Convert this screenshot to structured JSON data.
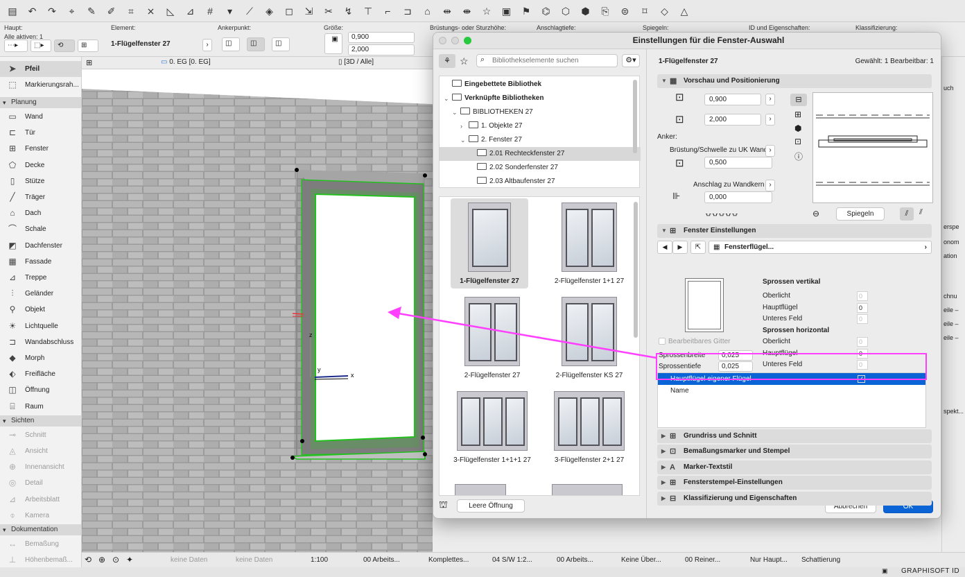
{
  "toolbar": {
    "icons": [
      "save-icon",
      "undo-icon",
      "redo-icon",
      "pointer-tool-icon",
      "eyedropper-icon",
      "syringe-icon",
      "magic-wand-icon",
      "trace-icon",
      "snap-guides-icon",
      "guide-lines-icon",
      "grid-snap-icon",
      "gravity-icon",
      "pen-set-icon",
      "layer-icon",
      "suspend-groups-icon",
      "measure-icon",
      "scissors-icon",
      "adjust-icon",
      "elevate-icon",
      "fillet-icon",
      "offset-icon",
      "roof-trim-icon",
      "distribute-icon",
      "align-icon",
      "favorites-icon",
      "selection-settings-icon",
      "flag-icon",
      "renovation-icon",
      "3d-explode-icon",
      "model-icon",
      "publisher-icon",
      "attributes-icon",
      "tag-icon",
      "view-icon",
      "solid-ops-icon"
    ]
  },
  "infobox": {
    "main_label": "Haupt:",
    "active_label": "Alle aktiven: 1",
    "element_label": "Element:",
    "element_value": "1-Flügelfenster 27",
    "anchor_label": "Ankerpunkt:",
    "size_label": "Größe:",
    "width": "0,900",
    "height": "2,000",
    "sill_label": "Brüstungs- oder Sturzhöhe:",
    "reveal_label": "Anschlagtiefe:",
    "mirror_label": "Spiegeln:",
    "id_label": "ID und Eigenschaften:",
    "class_label": "Klassifizierung:"
  },
  "tabs": {
    "floor": "0. EG [0. EG]",
    "view3d": "[3D / Alle]"
  },
  "palette": {
    "tools_top": [
      {
        "label": "Pfeil",
        "icon": "arrow-icon"
      },
      {
        "label": "Markierungsrah...",
        "icon": "marquee-icon"
      }
    ],
    "sections": [
      {
        "title": "Planung",
        "items": [
          {
            "label": "Wand",
            "icon": "wall-icon"
          },
          {
            "label": "Tür",
            "icon": "door-icon"
          },
          {
            "label": "Fenster",
            "icon": "window-icon"
          },
          {
            "label": "Decke",
            "icon": "slab-icon"
          },
          {
            "label": "Stütze",
            "icon": "column-icon"
          },
          {
            "label": "Träger",
            "icon": "beam-icon"
          },
          {
            "label": "Dach",
            "icon": "roof-icon"
          },
          {
            "label": "Schale",
            "icon": "shell-icon"
          },
          {
            "label": "Dachfenster",
            "icon": "skylight-icon"
          },
          {
            "label": "Fassade",
            "icon": "curtain-wall-icon"
          },
          {
            "label": "Treppe",
            "icon": "stair-icon"
          },
          {
            "label": "Geländer",
            "icon": "railing-icon"
          },
          {
            "label": "Objekt",
            "icon": "object-icon"
          },
          {
            "label": "Lichtquelle",
            "icon": "lamp-icon"
          },
          {
            "label": "Wandabschluss",
            "icon": "wall-end-icon"
          },
          {
            "label": "Morph",
            "icon": "morph-icon"
          },
          {
            "label": "Freifläche",
            "icon": "mesh-icon"
          },
          {
            "label": "Öffnung",
            "icon": "opening-icon"
          },
          {
            "label": "Raum",
            "icon": "zone-icon"
          }
        ]
      },
      {
        "title": "Sichten",
        "items": [
          {
            "label": "Schnitt",
            "icon": "section-icon"
          },
          {
            "label": "Ansicht",
            "icon": "elevation-icon"
          },
          {
            "label": "Innenansicht",
            "icon": "interior-elevation-icon"
          },
          {
            "label": "Detail",
            "icon": "detail-icon"
          },
          {
            "label": "Arbeitsblatt",
            "icon": "worksheet-icon"
          },
          {
            "label": "Kamera",
            "icon": "camera-icon"
          }
        ]
      },
      {
        "title": "Dokumentation",
        "items": [
          {
            "label": "Bemaßung",
            "icon": "dimension-icon"
          },
          {
            "label": "Höhenbemaß...",
            "icon": "level-dimension-icon"
          }
        ]
      }
    ]
  },
  "statusbar": {
    "items": [
      "keine Daten",
      "keine Daten",
      "1:100",
      "00 Arbeits...",
      "Komplettes...",
      "04 S/W 1:2...",
      "00 Arbeits...",
      "Keine Über...",
      "00 Reiner...",
      "Nur Haupt...",
      "Schattierung"
    ]
  },
  "dialog": {
    "title": "Einstellungen für die Fenster-Auswahl",
    "search_placeholder": "Bibliothekselemente suchen",
    "tree": [
      {
        "label": "Eingebettete Bibliothek",
        "level": 0,
        "bold": true,
        "twisty": ""
      },
      {
        "label": "Verknüpfte Bibliotheken",
        "level": 0,
        "bold": true,
        "twisty": "v"
      },
      {
        "label": "BIBLIOTHEKEN 27",
        "level": 1,
        "twisty": "v"
      },
      {
        "label": "1. Objekte 27",
        "level": 2,
        "twisty": ">"
      },
      {
        "label": "2. Fenster 27",
        "level": 2,
        "twisty": "v"
      },
      {
        "label": "2.01 Rechteckfenster 27",
        "level": 3,
        "twisty": "",
        "selected": true
      },
      {
        "label": "2.02 Sonderfenster 27",
        "level": 3,
        "twisty": ""
      },
      {
        "label": "2.03 Altbaufenster 27",
        "level": 3,
        "twisty": ""
      }
    ],
    "gallery": [
      {
        "label": "1-Flügelfenster 27",
        "panes": 1,
        "selected": true
      },
      {
        "label": "2-Flügelfenster 1+1 27",
        "panes": 2
      },
      {
        "label": "2-Flügelfenster 27",
        "panes": 2
      },
      {
        "label": "2-Flügelfenster KS 27",
        "panes": 2
      },
      {
        "label": "3-Flügelfenster 1+1+1 27",
        "panes": 3
      },
      {
        "label": "3-Flügelfenster 2+1 27",
        "panes": 3
      }
    ],
    "empty_opening": "Leere Öffnung",
    "right": {
      "element_name": "1-Flügelfenster 27",
      "selection_info": "Gewählt: 1 Bearbeitbar: 1",
      "sec_preview": "Vorschau und Positionierung",
      "width": "0,900",
      "height": "2,000",
      "anchor_label": "Anker:",
      "sill_label": "Brüstung/Schwelle zu UK Wand",
      "sill_value": "0,500",
      "reveal_label": "Anschlag zu Wandkern",
      "reveal_value": "0,000",
      "mirror_button": "Spiegeln",
      "sec_window": "Fenster Einstellungen",
      "page_name": "Fensterflügel...",
      "mullions_v_title": "Sprossen vertikal",
      "mullions_v": [
        {
          "label": "Oberlicht",
          "value": "0",
          "disabled": true
        },
        {
          "label": "Hauptflügel",
          "value": "0"
        },
        {
          "label": "Unteres Feld",
          "value": "0",
          "disabled": true
        }
      ],
      "mullions_h_title": "Sprossen horizontal",
      "mullions_h": [
        {
          "label": "Oberlicht",
          "value": "0",
          "disabled": true
        },
        {
          "label": "Hauptflügel",
          "value": "0"
        },
        {
          "label": "Unteres Feld",
          "value": "0",
          "disabled": true
        }
      ],
      "editable_grid": "Bearbeitbares Gitter",
      "bar_width_label": "Sprossenbreite",
      "bar_width": "0,025",
      "bar_depth_label": "Sprossentiefe",
      "bar_depth": "0,025",
      "param_rows": [
        {
          "name": "Hauptflügel eigener Flügel",
          "checked": true,
          "selected": true
        },
        {
          "name": "Name",
          "value": ""
        }
      ],
      "sections_collapsed": [
        "Grundriss und Schnitt",
        "Bemaßungsmarker und Stempel",
        "Marker-Textstil",
        "Fensterstempel-Einstellungen",
        "Klassifizierung und Eigenschaften"
      ],
      "cancel": "Abbrechen",
      "ok": "OK"
    }
  },
  "right_strip": {
    "items": [
      "erspe",
      "onom",
      "ation",
      "chnu",
      "eile –",
      "eile –",
      "eile –",
      "spekt...",
      "uch"
    ]
  },
  "brand": "GRAPHISOFT ID",
  "colors": {
    "accent": "#0a64d6",
    "highlight": "#ff40ff",
    "select_green": "#23c11e",
    "panel": "#ececec"
  }
}
